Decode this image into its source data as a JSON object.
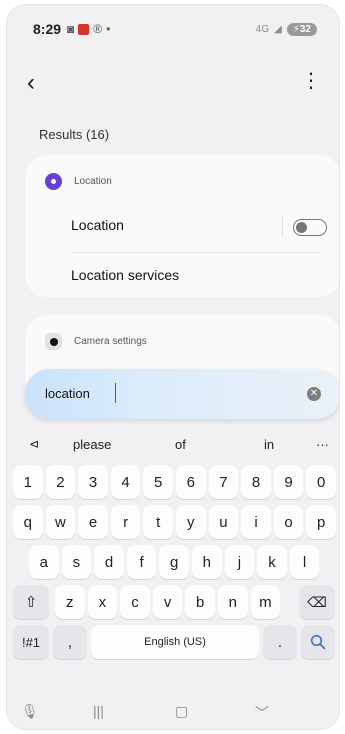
{
  "status_bar": {
    "time": "8:29",
    "dot": "•",
    "battery": "32",
    "network": "4G"
  },
  "app_bar": {
    "back_icon": "back-chevron-icon",
    "more_icon": "more-vert-icon"
  },
  "results_label": "Results (16)",
  "location_card": {
    "title": "Location",
    "rows": [
      "Location",
      "Location services"
    ],
    "toggle_on": false
  },
  "camera_card": {
    "title": "Camera settings"
  },
  "search": {
    "value": "location",
    "clear_icon": "clear-icon"
  },
  "keyboard": {
    "suggestions": [
      "please",
      "of",
      "in",
      "···"
    ],
    "number_row": [
      "1",
      "2",
      "3",
      "4",
      "5",
      "6",
      "7",
      "8",
      "9",
      "0"
    ],
    "row1": [
      "q",
      "w",
      "e",
      "r",
      "t",
      "y",
      "u",
      "i",
      "o",
      "p"
    ],
    "row2": [
      "a",
      "s",
      "d",
      "f",
      "g",
      "h",
      "j",
      "k",
      "l"
    ],
    "row3": [
      "z",
      "x",
      "c",
      "v",
      "b",
      "n",
      "m"
    ],
    "symbols_key": "!#1",
    "comma_key": ",",
    "space_label": "English (US)",
    "period_key": ".",
    "search_key": "search-icon"
  },
  "colors": {
    "accent": "#6a3fd9",
    "search_blue": "#3f6fd8"
  }
}
